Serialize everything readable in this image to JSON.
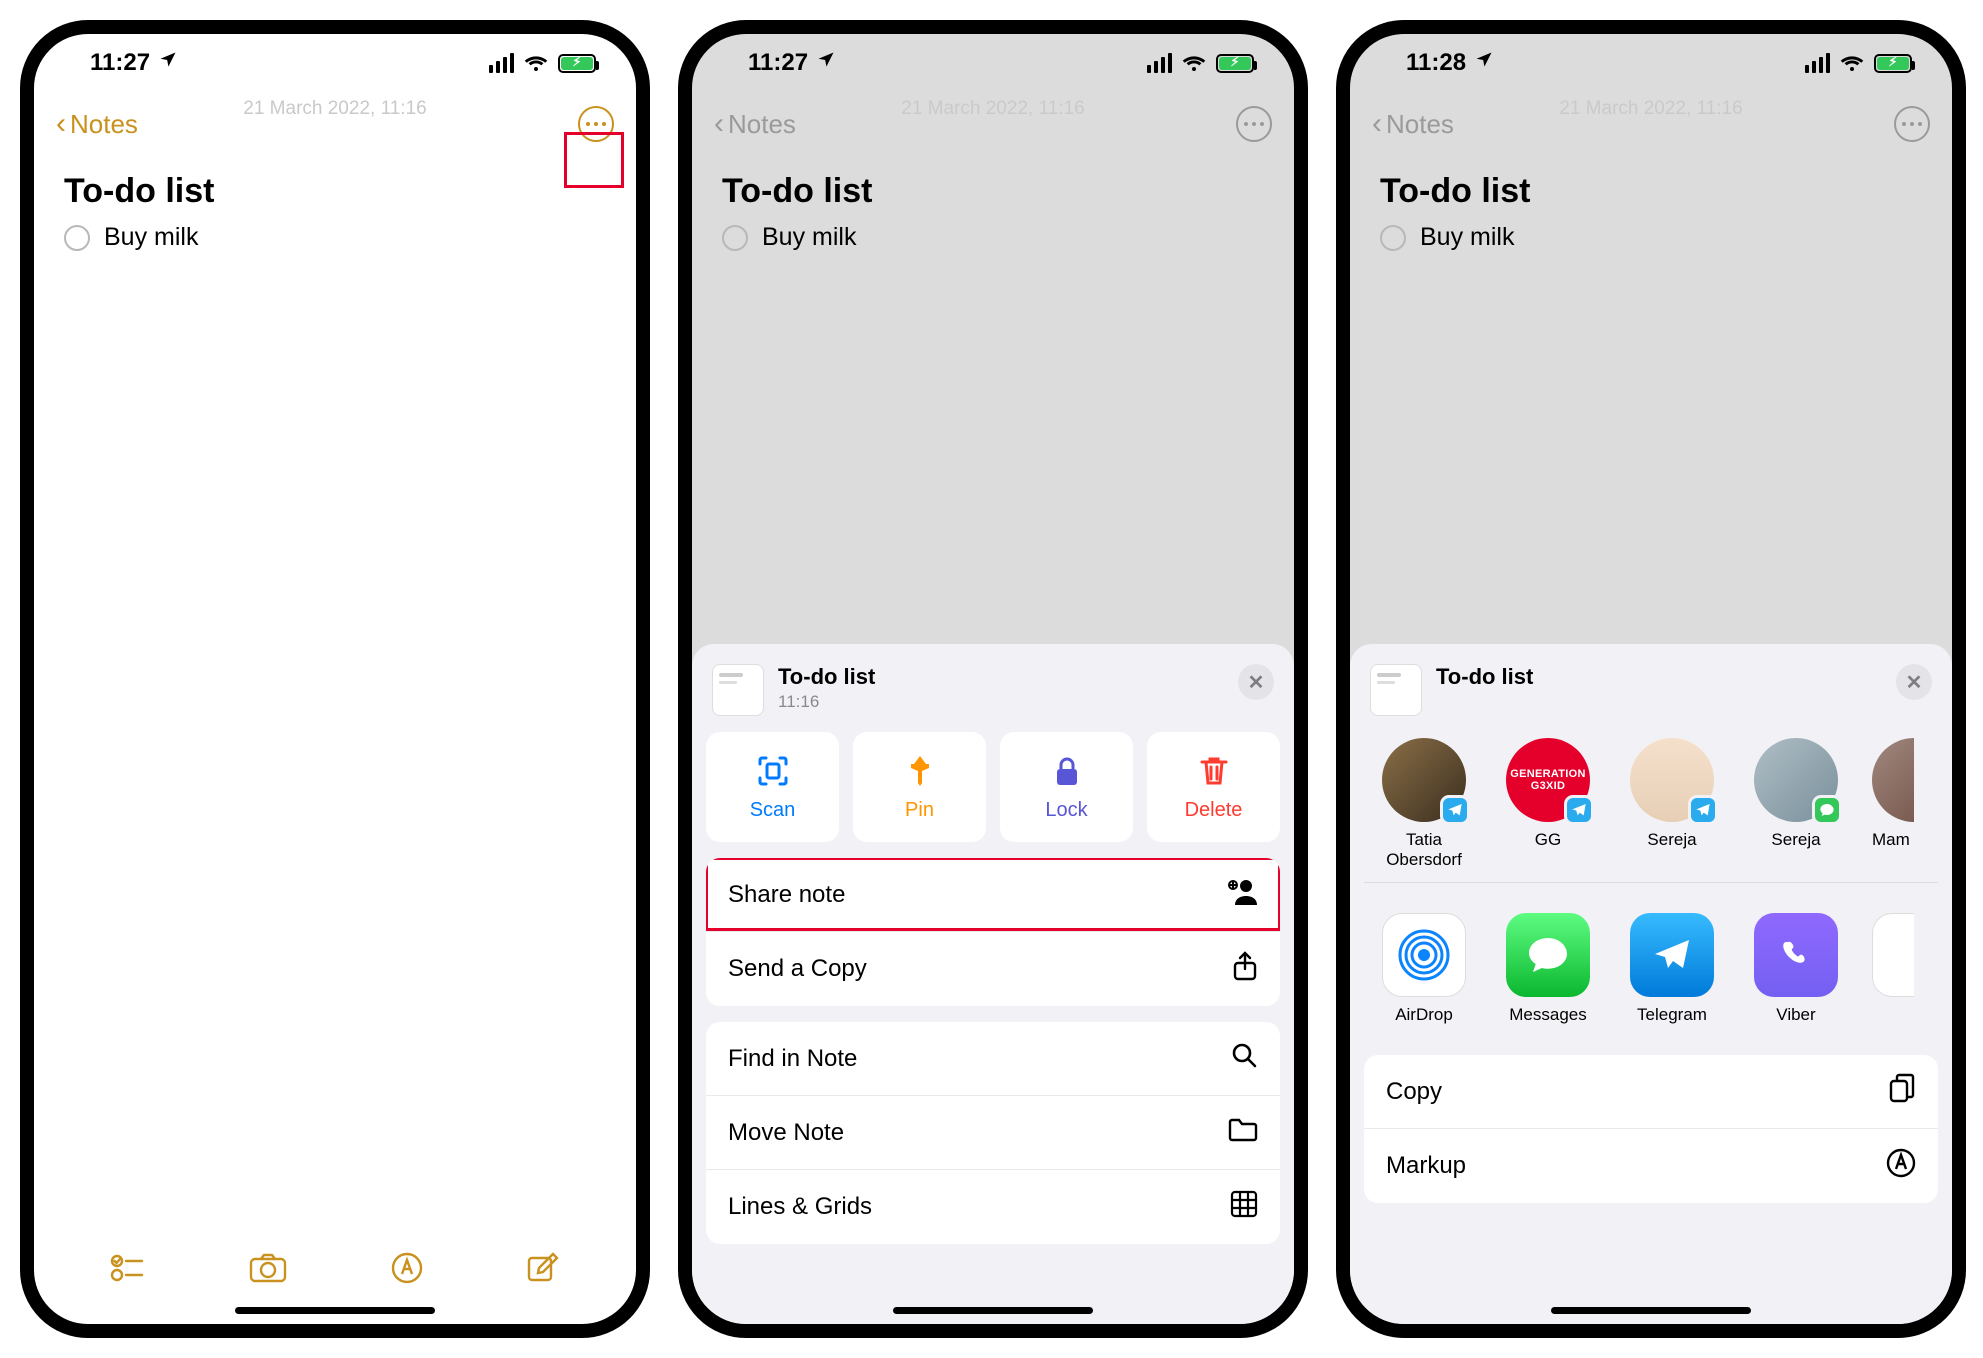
{
  "status": {
    "time_a": "11:27",
    "time_b": "11:27",
    "time_c": "11:28"
  },
  "nav": {
    "back_label": "Notes"
  },
  "note": {
    "date": "21 March 2022, 11:16",
    "title": "To-do list",
    "item1": "Buy milk"
  },
  "sheet2": {
    "title": "To-do list",
    "subtitle": "11:16",
    "quick": {
      "scan": "Scan",
      "pin": "Pin",
      "lock": "Lock",
      "delete": "Delete"
    },
    "rows_group1": {
      "share": "Share note",
      "send": "Send a Copy"
    },
    "rows_group2": {
      "find": "Find in Note",
      "move": "Move Note",
      "lines": "Lines & Grids"
    }
  },
  "sheet3": {
    "title": "To-do list",
    "contacts": {
      "c1_name": "Tatia Obersdorf",
      "c2_name": "GG",
      "c2_avatar_text": "GENERATION\nG3XID",
      "c3_name": "Sereja",
      "c4_name": "Sereja",
      "c5_name": "Mam"
    },
    "apps": {
      "a1": "AirDrop",
      "a2": "Messages",
      "a3": "Telegram",
      "a4": "Viber"
    },
    "rows": {
      "copy": "Copy",
      "markup": "Markup"
    }
  }
}
